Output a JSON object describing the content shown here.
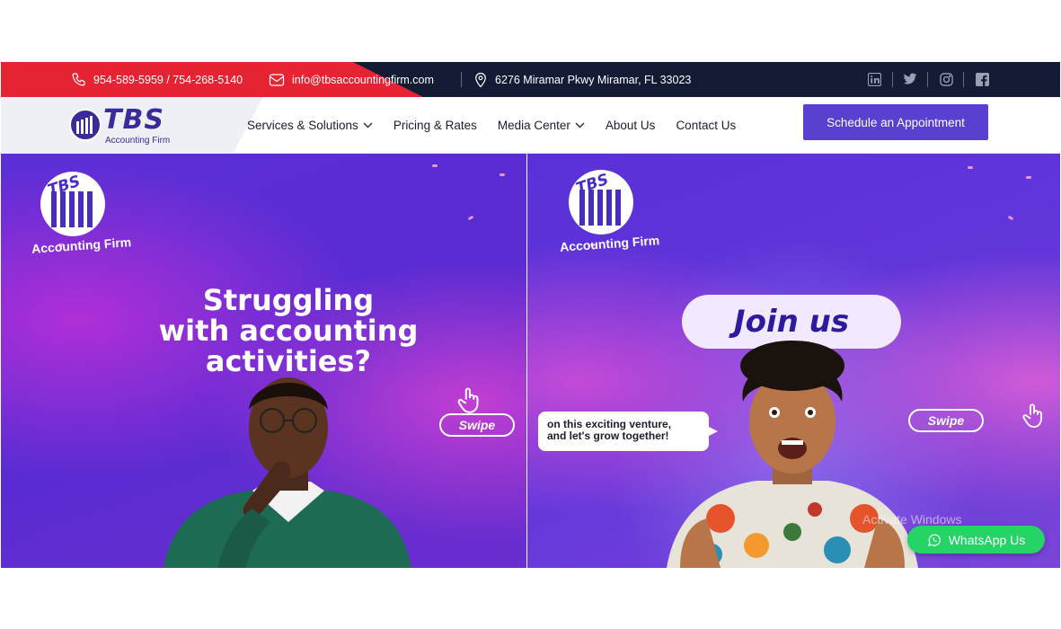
{
  "topbar": {
    "phone": "954-589-5959 / 754-268-5140",
    "email": "info@tbsaccountingfirm.com",
    "address": "6276 Miramar Pkwy Miramar, FL 33023",
    "social_icons": [
      "linkedin-icon",
      "twitter-icon",
      "instagram-icon",
      "facebook-icon"
    ],
    "colors": {
      "bar": "#141b34",
      "accent": "#e62333"
    }
  },
  "nav": {
    "logo_text": "TBS",
    "logo_subtitle": "Accounting Firm",
    "items": [
      {
        "label": "Services & Solutions",
        "dropdown": true
      },
      {
        "label": "Pricing & Rates",
        "dropdown": false
      },
      {
        "label": "Media Center",
        "dropdown": true
      },
      {
        "label": "About Us",
        "dropdown": false
      },
      {
        "label": "Contact Us",
        "dropdown": false
      }
    ],
    "cta": "Schedule an Appointment",
    "colors": {
      "cta": "#5b3fd0",
      "brand": "#3a2a9a"
    }
  },
  "hero": {
    "slide1": {
      "logo_text": "TBS",
      "logo_caption": "Accounting Firm",
      "headline_lines": [
        "Struggling",
        "with accounting",
        "activities?"
      ],
      "swipe": "Swipe"
    },
    "slide2": {
      "logo_text": "TBS",
      "logo_caption": "Accounting Firm",
      "pill": "Join us",
      "bubble_lines": [
        "on this exciting venture,",
        "and let's grow together!"
      ],
      "swipe": "Swipe"
    }
  },
  "overlay": {
    "watermark": "Activate Windows",
    "whatsapp": "WhatsApp Us"
  }
}
